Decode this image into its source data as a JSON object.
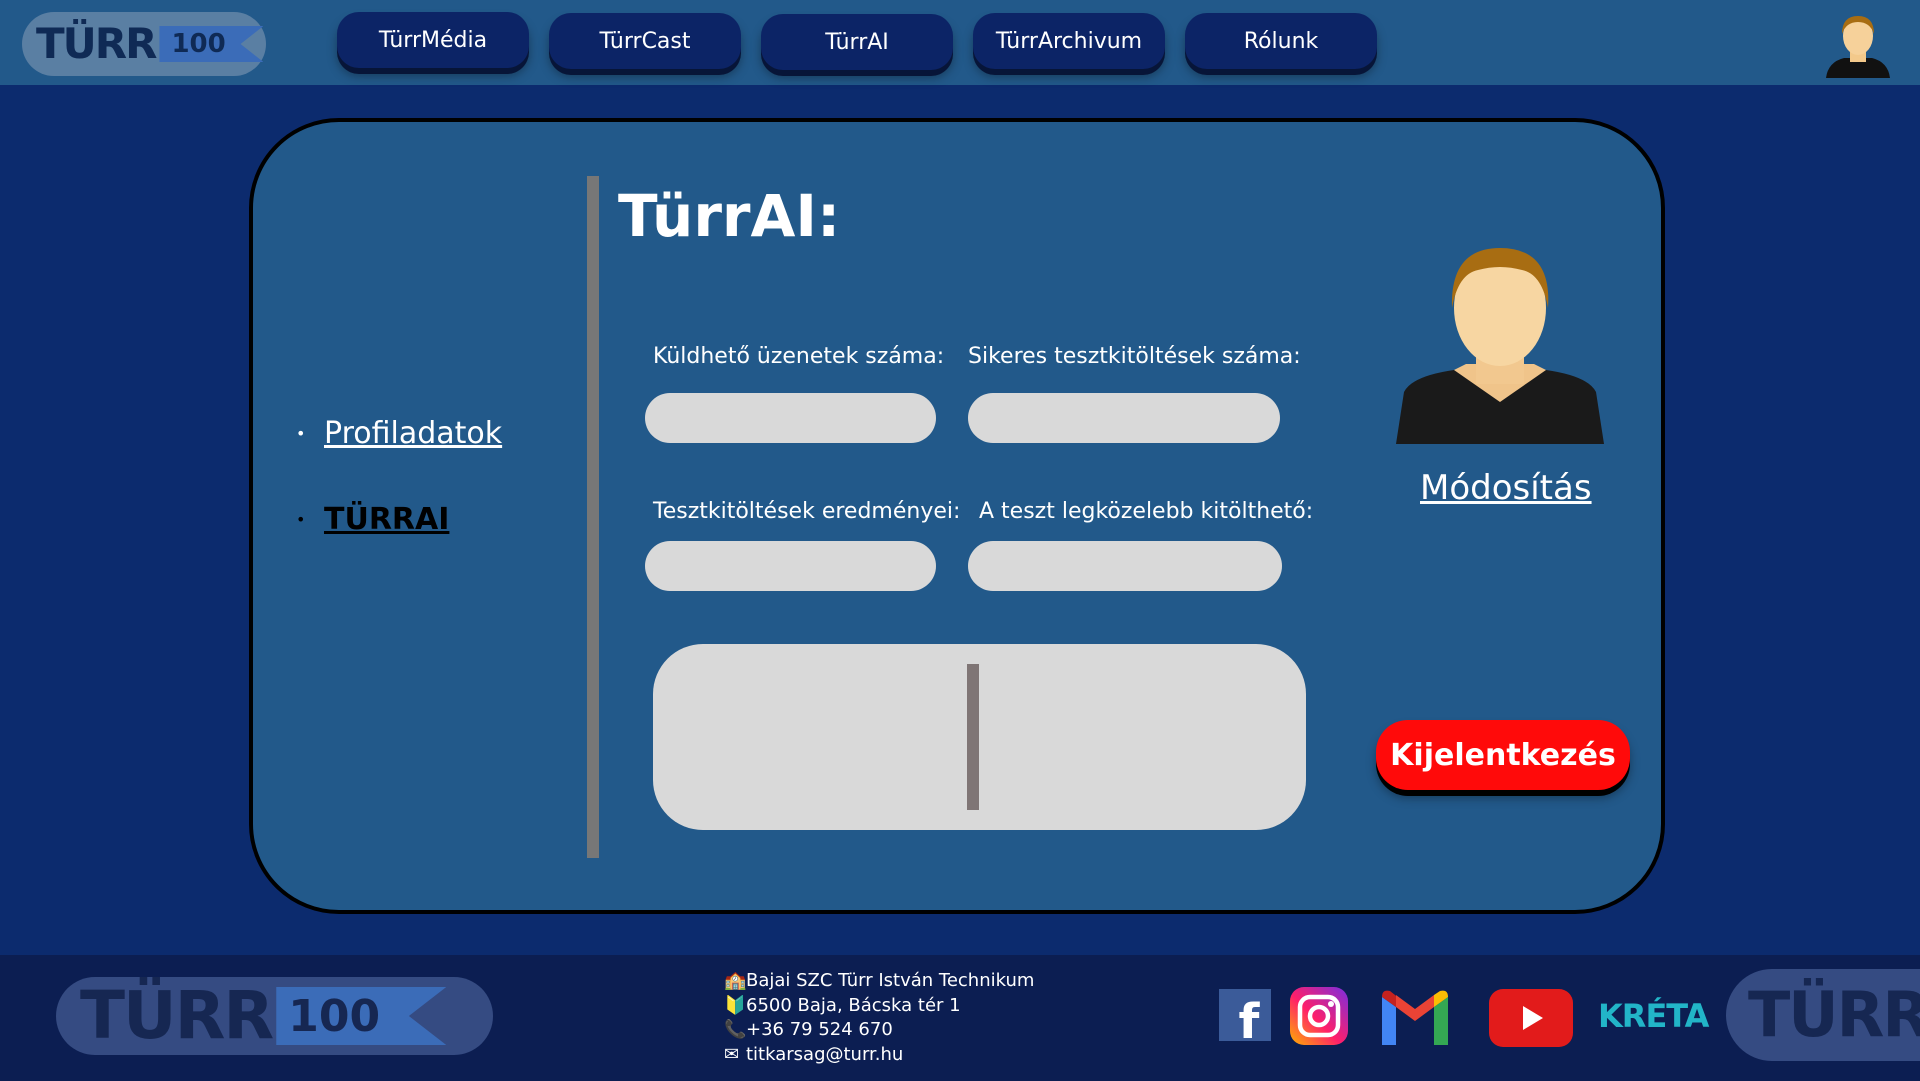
{
  "nav": {
    "logo_text": "TÜRR",
    "logo_badge": "100",
    "items": [
      {
        "label": "TürrMédia"
      },
      {
        "label": "TürrCast"
      },
      {
        "label": "TürrAI"
      },
      {
        "label": "TürrArchivum"
      },
      {
        "label": "Rólunk"
      }
    ],
    "avatar_icon": "user-avatar-icon"
  },
  "sidebar": {
    "items": [
      {
        "label": "Profiladatok",
        "active": false
      },
      {
        "label": "TÜRRAI",
        "active": true
      }
    ]
  },
  "main": {
    "title": "TürrAI:",
    "fields": [
      {
        "label": "Küldhető üzenetek száma:",
        "value": ""
      },
      {
        "label": "Sikeres tesztkitöltések száma:",
        "value": ""
      },
      {
        "label": "Tesztkitöltések eredményei:",
        "value": ""
      },
      {
        "label": "A teszt legközelebb kitölthető:",
        "value": ""
      }
    ]
  },
  "profile": {
    "modify_label": "Módosítás",
    "logout_label": "Kijelentkezés"
  },
  "footer": {
    "logo_text": "TÜRR",
    "logo_badge": "100",
    "contact": {
      "school": "Bajai SZC Türr István Technikum",
      "address": "6500 Baja, Bácska tér 1",
      "phone": "+36 79 524 670",
      "email": "titkarsag@turr.hu"
    },
    "social": {
      "facebook_letter": "f",
      "kreta_label": "KRÉTA"
    }
  },
  "colors": {
    "nav_bg": "#22598a",
    "page_bg": "#0c2b6e",
    "card_bg": "#22598a",
    "nav_button": "#0c2466",
    "logout": "#ff0a0a",
    "input": "#d9d9d9"
  }
}
